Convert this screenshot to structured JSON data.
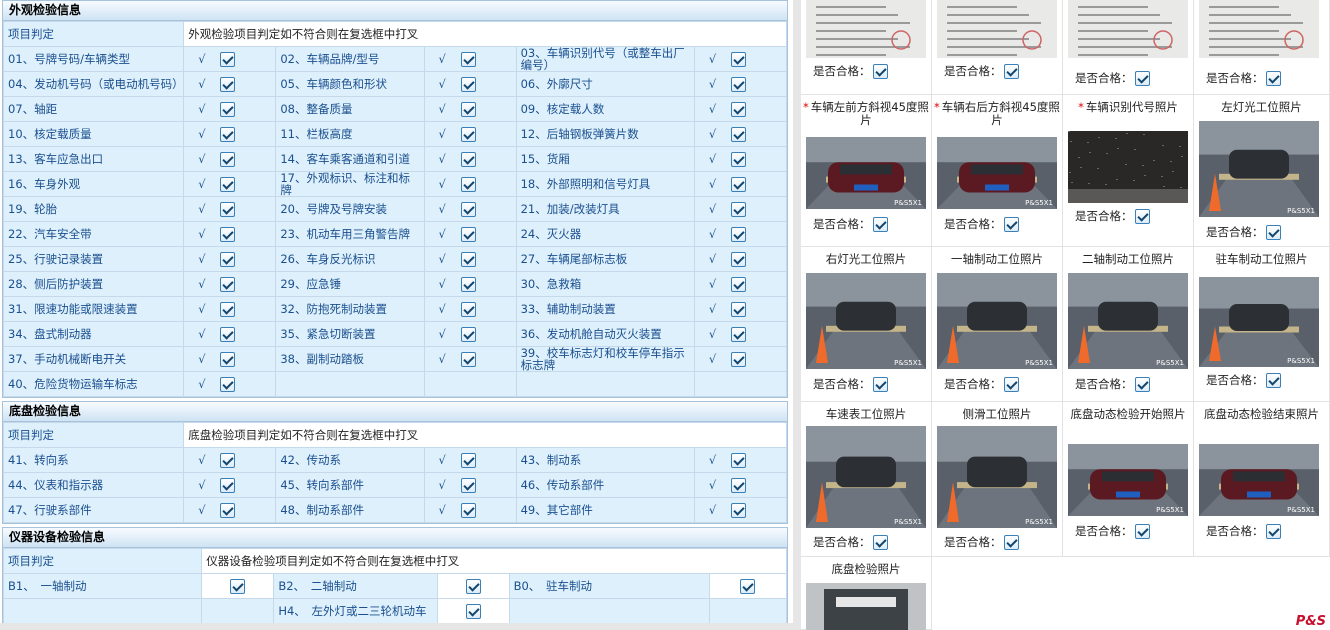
{
  "appearance": {
    "title": "外观检验信息",
    "judge_label": "项目判定",
    "judge_text": "外观检验项目判定如不符合则在复选框中打叉",
    "check_mark": "√",
    "rows": [
      [
        "01、号牌号码/车辆类型",
        "02、车辆品牌/型号",
        "03、车辆识别代号（或整车出厂编号）"
      ],
      [
        "04、发动机号码（或电动机号码）",
        "05、车辆颜色和形状",
        "06、外廓尺寸"
      ],
      [
        "07、轴距",
        "08、整备质量",
        "09、核定载人数"
      ],
      [
        "10、核定载质量",
        "11、栏板高度",
        "12、后轴钢板弹簧片数"
      ],
      [
        "13、客车应急出口",
        "14、客车乘客通道和引道",
        "15、货厢"
      ],
      [
        "16、车身外观",
        "17、外观标识、标注和标牌",
        "18、外部照明和信号灯具"
      ],
      [
        "19、轮胎",
        "20、号牌及号牌安装",
        "21、加装/改装灯具"
      ],
      [
        "22、汽车安全带",
        "23、机动车用三角警告牌",
        "24、灭火器"
      ],
      [
        "25、行驶记录装置",
        "26、车身反光标识",
        "27、车辆尾部标志板"
      ],
      [
        "28、侧后防护装置",
        "29、应急锤",
        "30、急救箱"
      ],
      [
        "31、限速功能或限速装置",
        "32、防抱死制动装置",
        "33、辅助制动装置"
      ],
      [
        "34、盘式制动器",
        "35、紧急切断装置",
        "36、发动机舱自动灭火装置"
      ],
      [
        "37、手动机械断电开关",
        "38、副制动踏板",
        "39、校车标志灯和校车停车指示标志牌"
      ],
      [
        "40、危险货物运输车标志",
        "",
        ""
      ]
    ]
  },
  "chassis": {
    "title": "底盘检验信息",
    "judge_label": "项目判定",
    "judge_text": "底盘检验项目判定如不符合则在复选框中打叉",
    "rows": [
      [
        "41、转向系",
        "42、传动系",
        "43、制动系"
      ],
      [
        "44、仪表和指示器",
        "45、转向系部件",
        "46、传动系部件"
      ],
      [
        "47、行驶系部件",
        "48、制动系部件",
        "49、其它部件"
      ]
    ]
  },
  "instrument": {
    "title": "仪器设备检验信息",
    "judge_label": "项目判定",
    "judge_text": "仪器设备检验项目判定如不符合则在复选框中打叉",
    "rows": [
      [
        "B1、　一轴制动",
        "B2、　二轴制动",
        "B0、　驻车制动"
      ],
      [
        "",
        "H4、　左外灯或二三轮机动车",
        ""
      ]
    ]
  },
  "photos": {
    "qualified_label": "是否合格：",
    "watermark": "P&S5X1",
    "items": [
      {
        "title": "",
        "required": false,
        "scene": "doc"
      },
      {
        "title": "",
        "required": false,
        "scene": "doc"
      },
      {
        "title": "",
        "required": false,
        "scene": "doc"
      },
      {
        "title": "",
        "required": false,
        "scene": "doc"
      },
      {
        "title": "车辆左前方斜视45度照片",
        "required": true,
        "scene": "car-front"
      },
      {
        "title": "车辆右后方斜视45度照片",
        "required": true,
        "scene": "car-rear"
      },
      {
        "title": "车辆识别代号照片",
        "required": true,
        "scene": "vin"
      },
      {
        "title": "左灯光工位照片",
        "required": false,
        "scene": "lane"
      },
      {
        "title": "右灯光工位照片",
        "required": false,
        "scene": "lane"
      },
      {
        "title": "一轴制动工位照片",
        "required": false,
        "scene": "lane"
      },
      {
        "title": "二轴制动工位照片",
        "required": false,
        "scene": "lane"
      },
      {
        "title": "驻车制动工位照片",
        "required": false,
        "scene": "lane"
      },
      {
        "title": "车速表工位照片",
        "required": false,
        "scene": "lane"
      },
      {
        "title": "侧滑工位照片",
        "required": false,
        "scene": "lane"
      },
      {
        "title": "底盘动态检验开始照片",
        "required": false,
        "scene": "car-rear"
      },
      {
        "title": "底盘动态检验结束照片",
        "required": false,
        "scene": "car-rear"
      },
      {
        "title": "底盘检验照片",
        "required": false,
        "scene": "underbody"
      }
    ]
  },
  "brand_logo": "P&S"
}
